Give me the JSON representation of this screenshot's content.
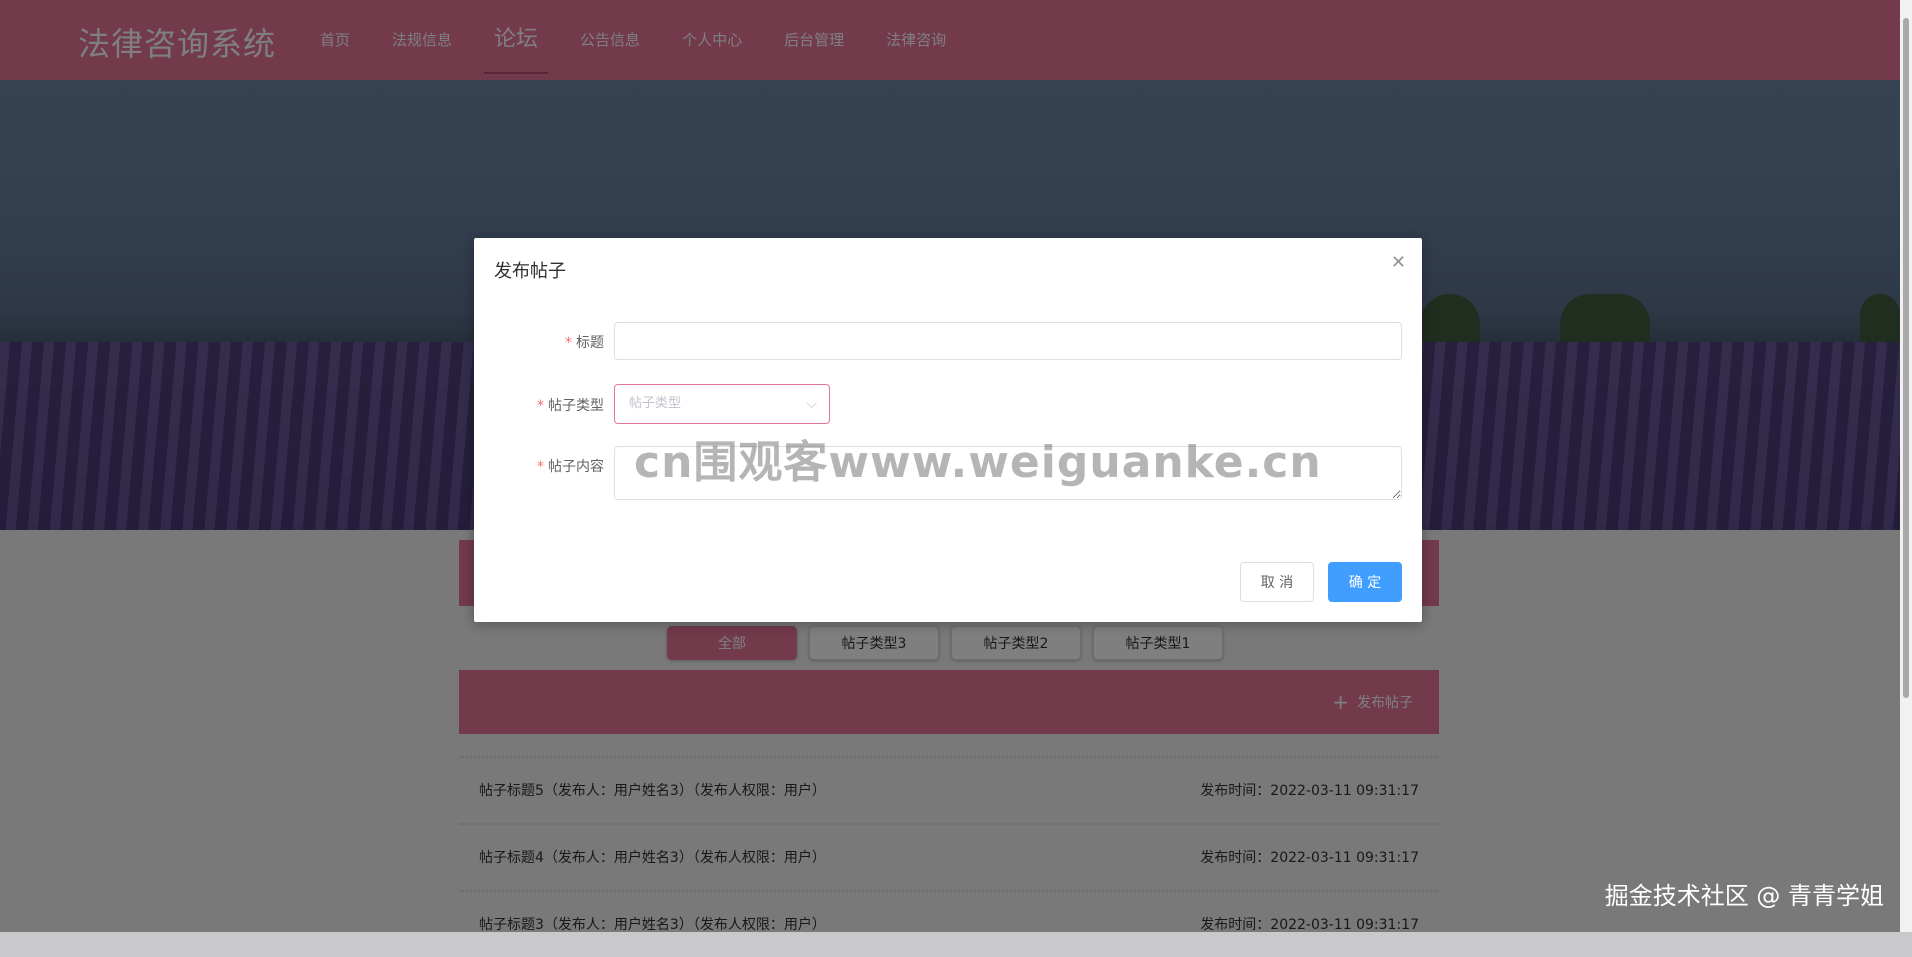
{
  "app": {
    "title": "法律咨询系统"
  },
  "nav": {
    "items": [
      {
        "label": "首页",
        "active": false
      },
      {
        "label": "法规信息",
        "active": false
      },
      {
        "label": "论坛",
        "active": true
      },
      {
        "label": "公告信息",
        "active": false
      },
      {
        "label": "个人中心",
        "active": false
      },
      {
        "label": "后台管理",
        "active": false
      },
      {
        "label": "法律咨询",
        "active": false
      }
    ]
  },
  "types": {
    "items": [
      {
        "label": "全部",
        "active": true
      },
      {
        "label": "帖子类型3",
        "active": false
      },
      {
        "label": "帖子类型2",
        "active": false
      },
      {
        "label": "帖子类型1",
        "active": false
      }
    ]
  },
  "publish": {
    "label": "发布帖子",
    "icon": "plus-icon"
  },
  "posts": [
    {
      "title": "帖子标题5（发布人：用户姓名3）（发布人权限：用户）",
      "time": "发布时间：2022-03-11 09:31:17"
    },
    {
      "title": "帖子标题4（发布人：用户姓名3）（发布人权限：用户）",
      "time": "发布时间：2022-03-11 09:31:17"
    },
    {
      "title": "帖子标题3（发布人：用户姓名3）（发布人权限：用户）",
      "time": "发布时间：2022-03-11 09:31:17"
    }
  ],
  "dialog": {
    "title": "发布帖子",
    "close_icon": "close-icon",
    "fields": {
      "title_label": "标题",
      "title_value": "",
      "type_label": "帖子类型",
      "type_placeholder": "帖子类型",
      "content_label": "帖子内容",
      "content_value": ""
    },
    "cancel_label": "取 消",
    "ok_label": "确 定"
  },
  "watermark": "cn围观客www.weiguanke.cn",
  "credit": "掘金技术社区 @ 青青学姐",
  "colors": {
    "brand": "#e57597",
    "primary": "#409eff",
    "required": "#f56c6c"
  }
}
